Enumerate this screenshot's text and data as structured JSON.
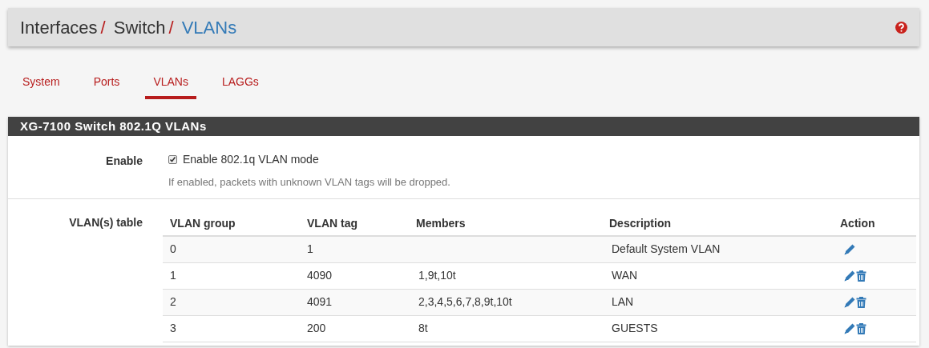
{
  "breadcrumb": [
    {
      "label": "Interfaces",
      "current": false
    },
    {
      "label": "Switch",
      "current": false
    },
    {
      "label": "VLANs",
      "current": true
    }
  ],
  "separator": "/",
  "tabs": [
    {
      "label": "System",
      "selected": false
    },
    {
      "label": "Ports",
      "selected": false
    },
    {
      "label": "VLANs",
      "selected": true
    },
    {
      "label": "LAGGs",
      "selected": false
    }
  ],
  "panel": {
    "title": "XG-7100 Switch 802.1Q VLANs",
    "enable": {
      "label": "Enable",
      "checked": true,
      "text": "Enable 802.1q VLAN mode",
      "help": "If enabled, packets with unknown VLAN tags will be dropped."
    },
    "table_label": "VLAN(s) table",
    "table": {
      "columns": [
        "VLAN group",
        "VLAN tag",
        "Members",
        "Description",
        "Action"
      ],
      "rows": [
        {
          "group": "0",
          "tag": "1",
          "members": "",
          "description": "Default System VLAN",
          "deletable": false
        },
        {
          "group": "1",
          "tag": "4090",
          "members": "1,9t,10t",
          "description": "WAN",
          "deletable": true
        },
        {
          "group": "2",
          "tag": "4091",
          "members": "2,3,4,5,6,7,8,9t,10t",
          "description": "LAN",
          "deletable": true
        },
        {
          "group": "3",
          "tag": "200",
          "members": "8t",
          "description": "GUESTS",
          "deletable": true
        }
      ]
    }
  }
}
